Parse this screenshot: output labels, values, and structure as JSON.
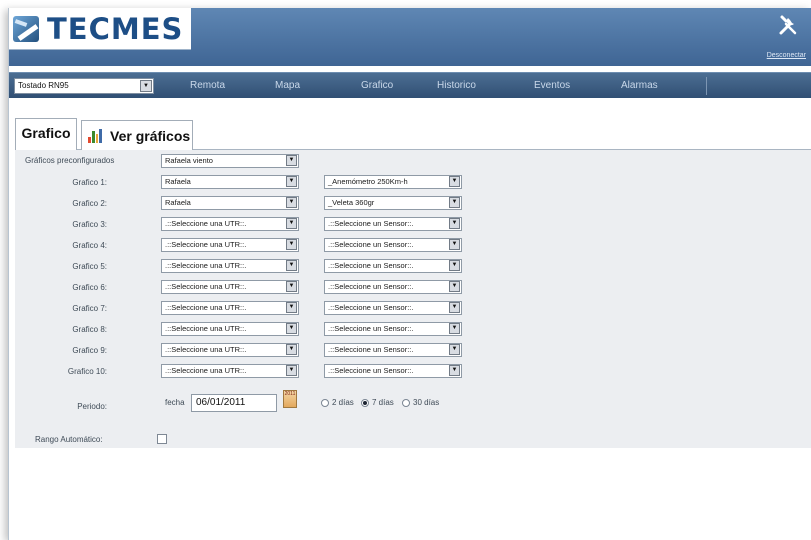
{
  "header": {
    "logo_text": "TECMES",
    "logout_label": "Desconectar",
    "tools_icon": "tools-icon"
  },
  "navbar": {
    "site_select": "Tostado RN95",
    "items": [
      "Remota",
      "Mapa",
      "Grafico",
      "Historico",
      "Eventos",
      "Alarmas"
    ]
  },
  "tabs": {
    "grafico": "Grafico",
    "ver_graficos": "Ver gráficos"
  },
  "form": {
    "preconfig_label": "Gráficos preconfigurados",
    "preconfig_value": "Rafaela viento",
    "rows": [
      {
        "label": "Grafico 1:",
        "utr": "Rafaela",
        "sensor": "_Anemómetro 250Km-h"
      },
      {
        "label": "Grafico 2:",
        "utr": "Rafaela",
        "sensor": "_Veleta 360gr"
      },
      {
        "label": "Grafico 3:",
        "utr": ".::Seleccione una UTR::.",
        "sensor": ".::Seleccione un Sensor::."
      },
      {
        "label": "Grafico 4:",
        "utr": ".::Seleccione una UTR::.",
        "sensor": ".::Seleccione un Sensor::."
      },
      {
        "label": "Grafico 5:",
        "utr": ".::Seleccione una UTR::.",
        "sensor": ".::Seleccione un Sensor::."
      },
      {
        "label": "Grafico 6:",
        "utr": ".::Seleccione una UTR::.",
        "sensor": ".::Seleccione un Sensor::."
      },
      {
        "label": "Grafico 7:",
        "utr": ".::Seleccione una UTR::.",
        "sensor": ".::Seleccione un Sensor::."
      },
      {
        "label": "Grafico 8:",
        "utr": ".::Seleccione una UTR::.",
        "sensor": ".::Seleccione un Sensor::."
      },
      {
        "label": "Grafico 9:",
        "utr": ".::Seleccione una UTR::.",
        "sensor": ".::Seleccione un Sensor::."
      },
      {
        "label": "Grafico 10:",
        "utr": ".::Seleccione una UTR::.",
        "sensor": ".::Seleccione un Sensor::."
      }
    ],
    "periodo_label": "Periodo:",
    "fecha_label": "fecha",
    "fecha_value": "06/01/2011",
    "periods": [
      {
        "label": "2 días",
        "selected": false
      },
      {
        "label": "7 días",
        "selected": true
      },
      {
        "label": "30 días",
        "selected": false
      }
    ],
    "rango_label": "Rango Automático:",
    "rango_checked": false
  }
}
